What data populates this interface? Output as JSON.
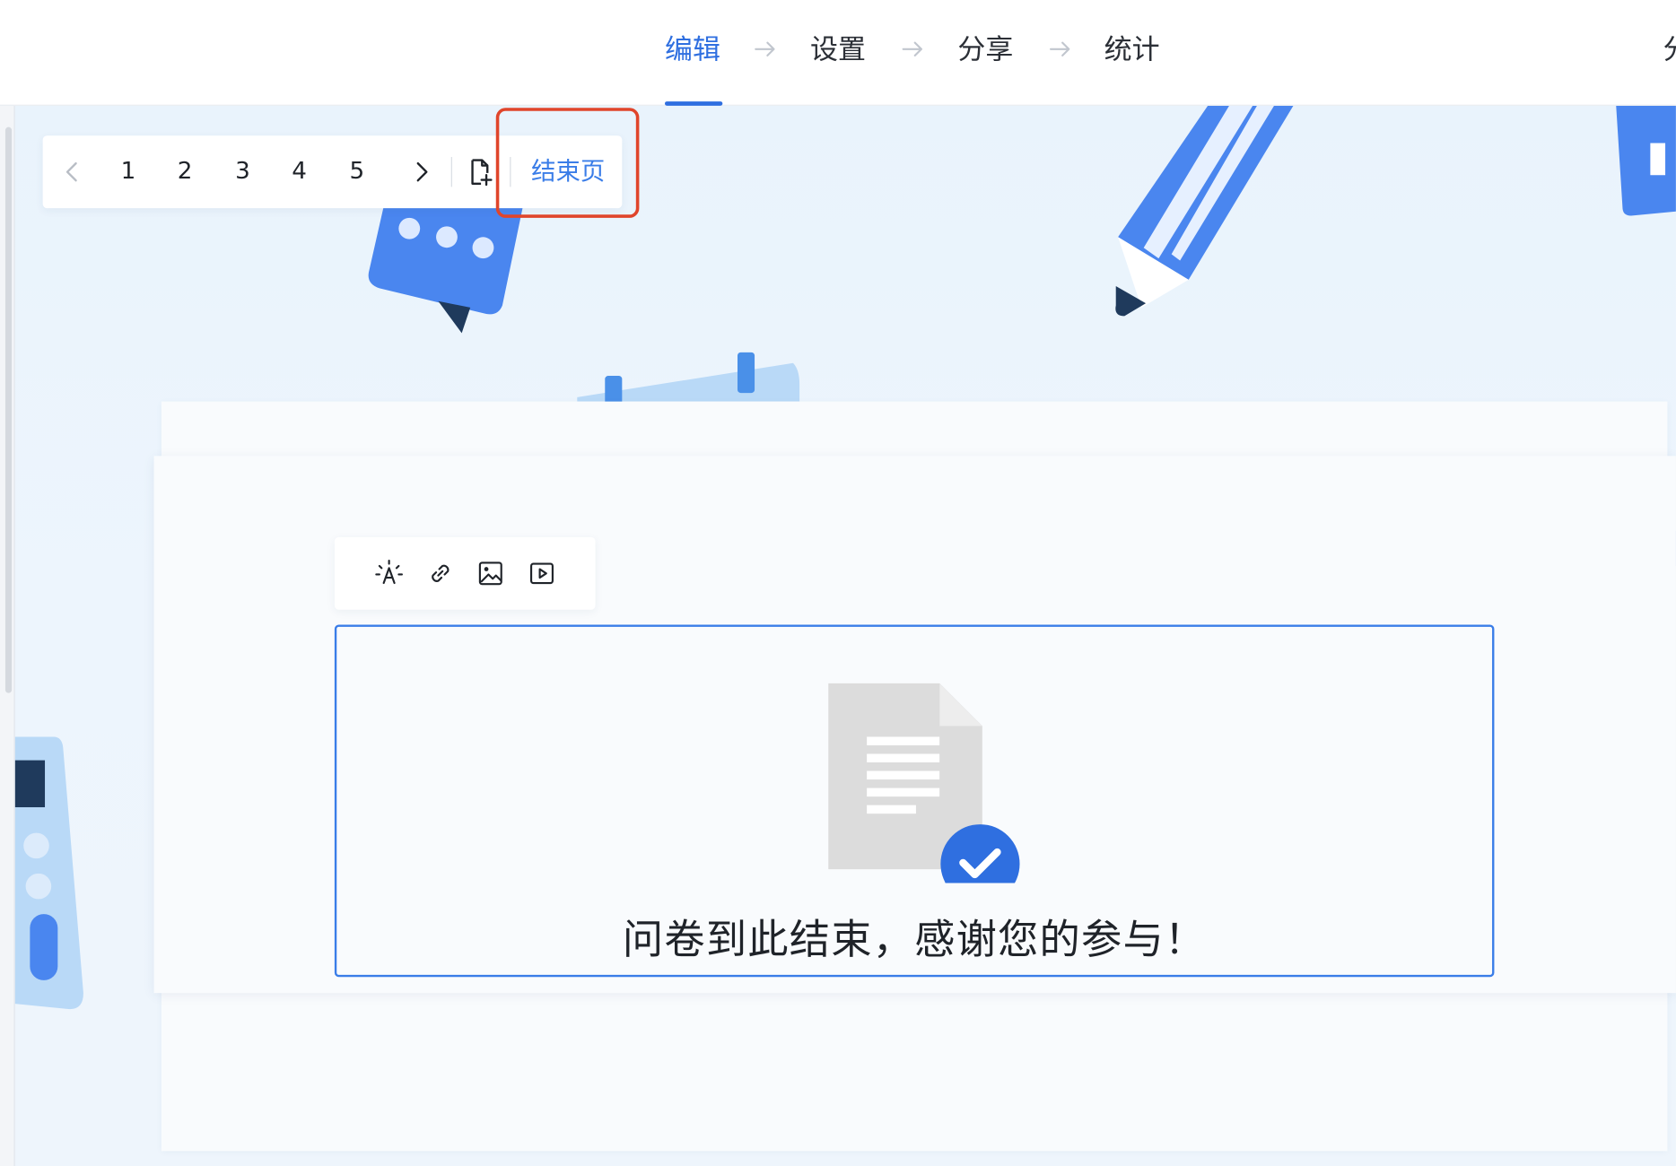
{
  "header": {
    "steps": [
      {
        "label": "编辑",
        "active": true
      },
      {
        "label": "设置",
        "active": false
      },
      {
        "label": "分享",
        "active": false
      },
      {
        "label": "统计",
        "active": false
      }
    ],
    "cut_label": "分",
    "accent_color": "#2f6fe0"
  },
  "pager": {
    "pages": [
      "1",
      "2",
      "3",
      "4",
      "5"
    ],
    "prev_icon": "chevron-left-icon",
    "next_icon": "chevron-right-icon",
    "add_icon": "add-page-icon",
    "end_page_label": "结束页",
    "highlight_color": "#e0452b"
  },
  "editor_toolbar": {
    "tools": [
      "text-style-icon",
      "link-icon",
      "image-icon",
      "video-icon"
    ]
  },
  "end_page": {
    "message": "问卷到此结束，感谢您的参与！",
    "illustration": "document-check-icon"
  }
}
